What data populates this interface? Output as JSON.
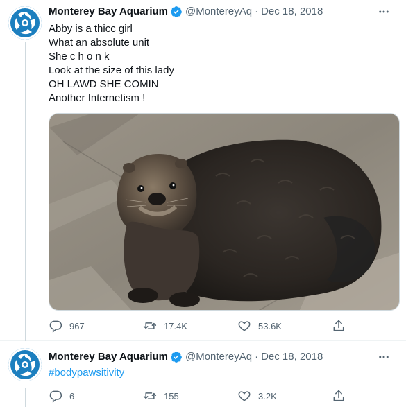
{
  "tweets": [
    {
      "author_name": "Monterey Bay Aquarium",
      "handle": "@MontereyAq",
      "separator": "·",
      "date": "Dec 18, 2018",
      "lines": [
        "Abby is a thicc girl",
        "What an absolute unit",
        "She c h o n k",
        "Look at the size of this lady",
        "OH LAWD SHE COMIN",
        "Another Internetism !"
      ],
      "media": "sea-otter-photo",
      "stats": {
        "replies": "967",
        "retweets": "17.4K",
        "likes": "53.6K"
      }
    },
    {
      "author_name": "Monterey Bay Aquarium",
      "handle": "@MontereyAq",
      "separator": "·",
      "date": "Dec 18, 2018",
      "lines": [
        "#bodypawsitivity"
      ],
      "stats": {
        "replies": "6",
        "retweets": "155",
        "likes": "3.2K"
      }
    }
  ],
  "icons": {
    "verified": "verified-badge-icon",
    "more": "more-options-icon",
    "reply": "reply-icon",
    "retweet": "retweet-icon",
    "like": "like-icon",
    "share": "share-icon"
  },
  "colors": {
    "verified": "#1d9bf0",
    "hashtag": "#1d9bf0",
    "muted": "#536471",
    "avatar": "#1c7fbf"
  }
}
